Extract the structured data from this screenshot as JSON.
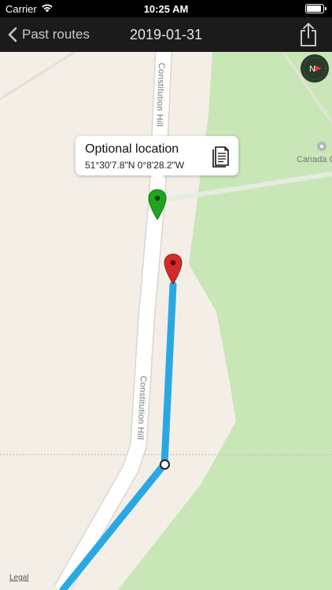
{
  "status_bar": {
    "carrier": "Carrier",
    "time": "10:25 AM",
    "battery_level": 1.0,
    "wifi_icon": "wifi-icon"
  },
  "nav_bar": {
    "back_label": "Past routes",
    "title": "2019-01-31",
    "back_icon": "chevron-left-icon",
    "share_icon": "share-icon"
  },
  "map": {
    "street_labels": [
      "Constitution Hill",
      "Constitution Hill"
    ],
    "poi_label": "Canada G",
    "legal_label": "Legal",
    "compass_label": "N",
    "colors": {
      "land": "#f3efe7",
      "park": "#c9e6b6",
      "road": "#ffffff",
      "route": "#2aa8e4",
      "start_pin": "#1ea51e",
      "end_pin": "#d32a2a"
    }
  },
  "callout": {
    "title": "Optional location",
    "coordinates": "51°30'7.8\"N 0°8'28.2\"W",
    "icon": "document-icon"
  }
}
